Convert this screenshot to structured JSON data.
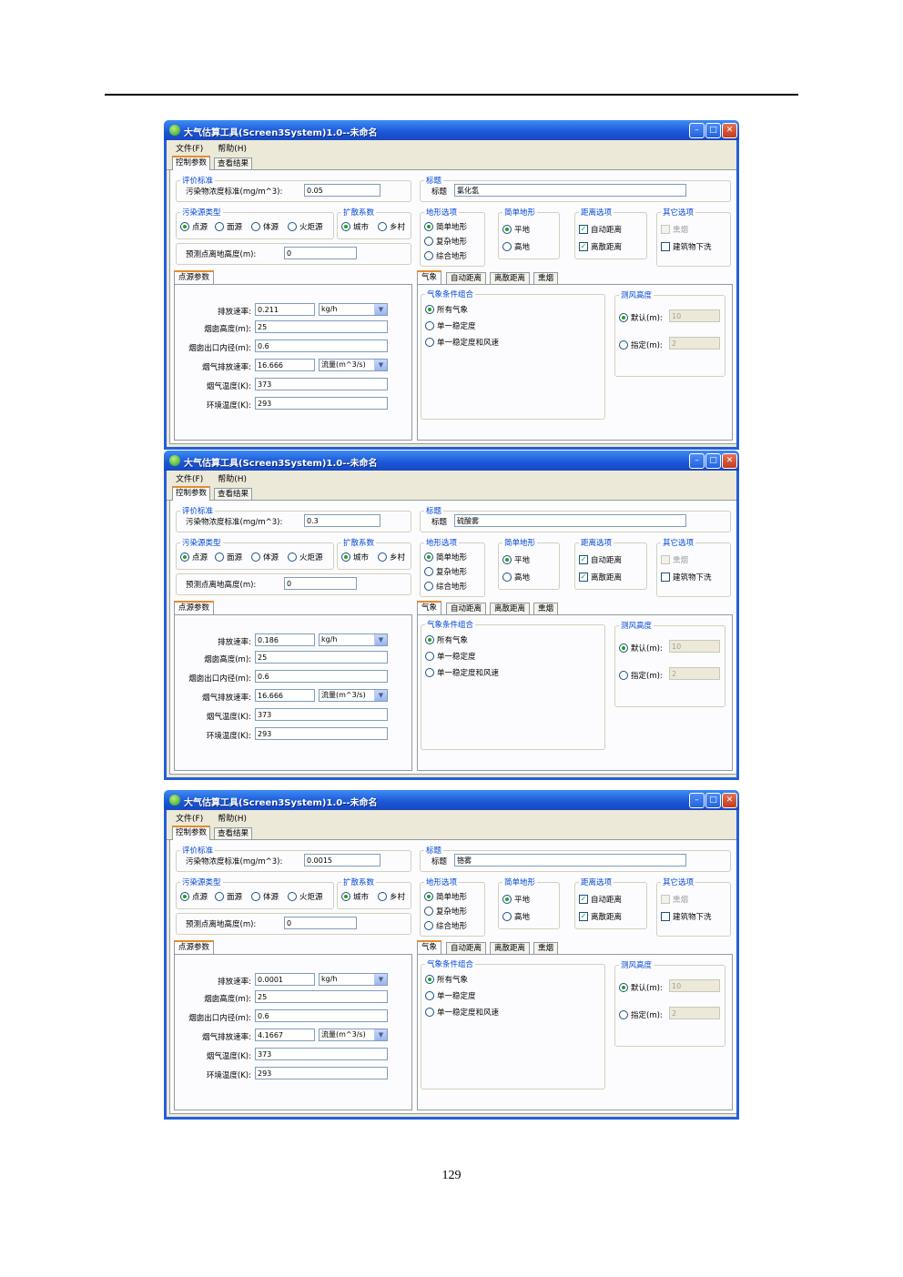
{
  "windows": [
    {
      "title": "大气估算工具(Screen3System)1.0--未命名",
      "menu": [
        "文件(F)",
        "帮助(H)"
      ],
      "tabs": [
        "控制参数",
        "查看结果"
      ],
      "standard_group": "评价标准",
      "standard_label": "污染物浓度标准(mg/m^3):",
      "standard_value": "0.05",
      "title_group": "标题",
      "title_label": "标题",
      "title_value": "氯化氢",
      "source_group": "污染源类型",
      "source_types": [
        "点源",
        "面源",
        "体源",
        "火炬源"
      ],
      "disp_group": "扩散系数",
      "disp_options": [
        "城市",
        "乡村"
      ],
      "terrain_group": "地形选项",
      "terrain_options": [
        "简单地形",
        "复杂地形",
        "综合地形"
      ],
      "simple_group": "简单地形",
      "simple_options": [
        "平地",
        "高地"
      ],
      "dist_group": "距离选项",
      "dist_options": [
        "自动距离",
        "离散距离"
      ],
      "other_group": "其它选项",
      "other_options": [
        "熏烟",
        "建筑物下洗"
      ],
      "receptor_label": "预测点离地高度(m):",
      "receptor_value": "0",
      "point_tab": "点源参数",
      "emission_label": "排放速率:",
      "emission_value": "0.211",
      "emission_unit": "kg/h",
      "stack_height_label": "烟囱高度(m):",
      "stack_height_value": "25",
      "stack_diam_label": "烟囱出口内径(m):",
      "stack_diam_value": "0.6",
      "exit_vel_label": "烟气排放速率:",
      "exit_vel_value": "16.666",
      "exit_vel_unit": "流量(m^3/s)",
      "gas_temp_label": "烟气温度(K):",
      "gas_temp_value": "373",
      "amb_temp_label": "环境温度(K):",
      "amb_temp_value": "293",
      "met_tabs": [
        "气象",
        "自动距离",
        "离散距离",
        "熏烟"
      ],
      "met_group": "气象条件组合",
      "met_options": [
        "所有气象",
        "单一稳定度",
        "单一稳定度和风速"
      ],
      "anem_group": "测风高度",
      "anem_default_label": "默认(m):",
      "anem_default_value": "10",
      "anem_custom_label": "指定(m):",
      "anem_custom_value": "2"
    },
    {
      "title": "大气估算工具(Screen3System)1.0--未命名",
      "menu": [
        "文件(F)",
        "帮助(H)"
      ],
      "tabs": [
        "控制参数",
        "查看结果"
      ],
      "standard_group": "评价标准",
      "standard_label": "污染物浓度标准(mg/m^3):",
      "standard_value": "0.3",
      "title_group": "标题",
      "title_label": "标题",
      "title_value": "硫酸雾",
      "source_group": "污染源类型",
      "source_types": [
        "点源",
        "面源",
        "体源",
        "火炬源"
      ],
      "disp_group": "扩散系数",
      "disp_options": [
        "城市",
        "乡村"
      ],
      "terrain_group": "地形选项",
      "terrain_options": [
        "简单地形",
        "复杂地形",
        "综合地形"
      ],
      "simple_group": "简单地形",
      "simple_options": [
        "平地",
        "高地"
      ],
      "dist_group": "距离选项",
      "dist_options": [
        "自动距离",
        "离散距离"
      ],
      "other_group": "其它选项",
      "other_options": [
        "熏烟",
        "建筑物下洗"
      ],
      "receptor_label": "预测点离地高度(m):",
      "receptor_value": "0",
      "point_tab": "点源参数",
      "emission_label": "排放速率:",
      "emission_value": "0.186",
      "emission_unit": "kg/h",
      "stack_height_label": "烟囱高度(m):",
      "stack_height_value": "25",
      "stack_diam_label": "烟囱出口内径(m):",
      "stack_diam_value": "0.6",
      "exit_vel_label": "烟气排放速率:",
      "exit_vel_value": "16.666",
      "exit_vel_unit": "流量(m^3/s)",
      "gas_temp_label": "烟气温度(K):",
      "gas_temp_value": "373",
      "amb_temp_label": "环境温度(K):",
      "amb_temp_value": "293",
      "met_tabs": [
        "气象",
        "自动距离",
        "离散距离",
        "熏烟"
      ],
      "met_group": "气象条件组合",
      "met_options": [
        "所有气象",
        "单一稳定度",
        "单一稳定度和风速"
      ],
      "anem_group": "测风高度",
      "anem_default_label": "默认(m):",
      "anem_default_value": "10",
      "anem_custom_label": "指定(m):",
      "anem_custom_value": "2"
    },
    {
      "title": "大气估算工具(Screen3System)1.0--未命名",
      "menu": [
        "文件(F)",
        "帮助(H)"
      ],
      "tabs": [
        "控制参数",
        "查看结果"
      ],
      "standard_group": "评价标准",
      "standard_label": "污染物浓度标准(mg/m^3):",
      "standard_value": "0.0015",
      "title_group": "标题",
      "title_label": "标题",
      "title_value": "铬雾",
      "source_group": "污染源类型",
      "source_types": [
        "点源",
        "面源",
        "体源",
        "火炬源"
      ],
      "disp_group": "扩散系数",
      "disp_options": [
        "城市",
        "乡村"
      ],
      "terrain_group": "地形选项",
      "terrain_options": [
        "简单地形",
        "复杂地形",
        "综合地形"
      ],
      "simple_group": "简单地形",
      "simple_options": [
        "平地",
        "高地"
      ],
      "dist_group": "距离选项",
      "dist_options": [
        "自动距离",
        "离散距离"
      ],
      "other_group": "其它选项",
      "other_options": [
        "熏烟",
        "建筑物下洗"
      ],
      "receptor_label": "预测点离地高度(m):",
      "receptor_value": "0",
      "point_tab": "点源参数",
      "emission_label": "排放速率:",
      "emission_value": "0.0001",
      "emission_unit": "kg/h",
      "stack_height_label": "烟囱高度(m):",
      "stack_height_value": "25",
      "stack_diam_label": "烟囱出口内径(m):",
      "stack_diam_value": "0.6",
      "exit_vel_label": "烟气排放速率:",
      "exit_vel_value": "4.1667",
      "exit_vel_unit": "流量(m^3/s)",
      "gas_temp_label": "烟气温度(K):",
      "gas_temp_value": "373",
      "amb_temp_label": "环境温度(K):",
      "amb_temp_value": "293",
      "met_tabs": [
        "气象",
        "自动距离",
        "离散距离",
        "熏烟"
      ],
      "met_group": "气象条件组合",
      "met_options": [
        "所有气象",
        "单一稳定度",
        "单一稳定度和风速"
      ],
      "anem_group": "测风高度",
      "anem_default_label": "默认(m):",
      "anem_default_value": "10",
      "anem_custom_label": "指定(m):",
      "anem_custom_value": "2"
    }
  ],
  "page_number": "129",
  "colors": {
    "titlebar": "#245edb",
    "face": "#ece9d8",
    "group_label": "#0046d5",
    "tab_highlight": "#e68b2c",
    "check_mark": "#21a121"
  }
}
